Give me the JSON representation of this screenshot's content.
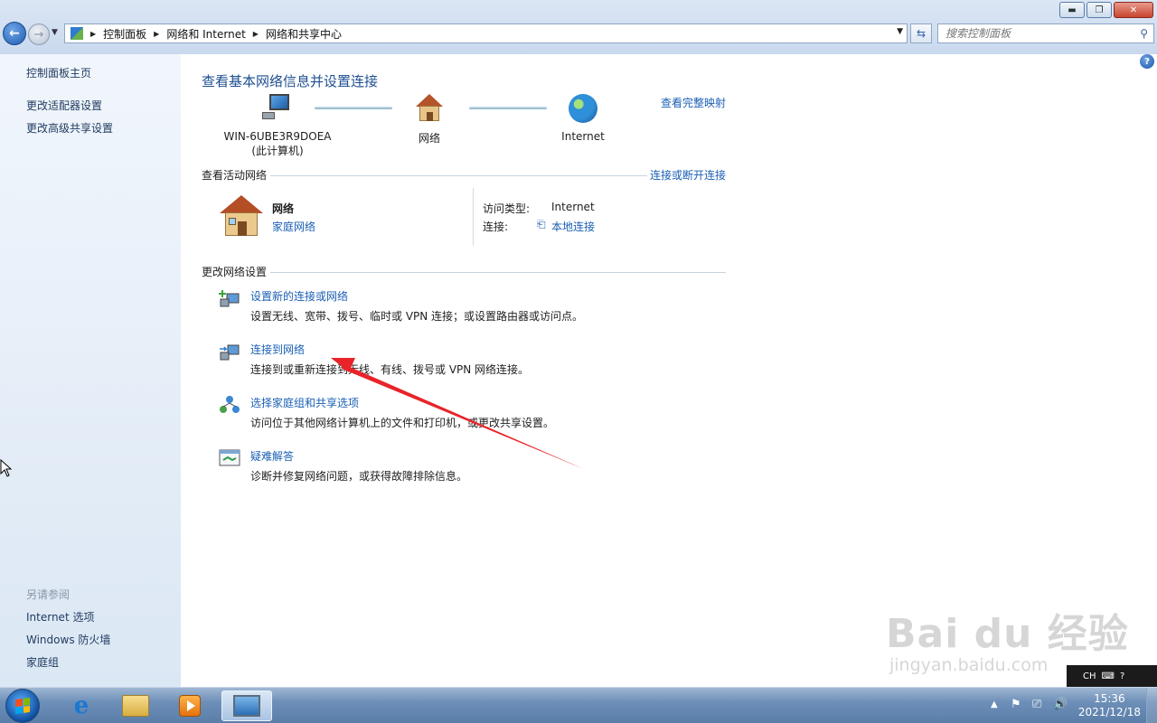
{
  "window": {
    "controls": {
      "minimize": "▬",
      "maximize": "❐",
      "close": "✕"
    }
  },
  "nav": {
    "breadcrumbs": [
      "控制面板",
      "网络和 Internet",
      "网络和共享中心"
    ],
    "search_placeholder": "搜索控制面板"
  },
  "sidebar": {
    "links": [
      "控制面板主页",
      "更改适配器设置",
      "更改高级共享设置"
    ],
    "see_also_heading": "另请参阅",
    "see_also": [
      "Internet 选项",
      "Windows 防火墙",
      "家庭组"
    ]
  },
  "main": {
    "title": "查看基本网络信息并设置连接",
    "full_map_link": "查看完整映射",
    "map": {
      "computer_name": "WIN-6UBE3R9DOEA",
      "computer_sub": "(此计算机)",
      "network_label": "网络",
      "internet_label": "Internet"
    },
    "active_networks": {
      "heading": "查看活动网络",
      "connect_disconnect": "连接或断开连接",
      "network_name": "网络",
      "network_type": "家庭网络",
      "access_type_label": "访问类型:",
      "access_type_value": "Internet",
      "connection_label": "连接:",
      "connection_value": "本地连接"
    },
    "change_settings": {
      "heading": "更改网络设置",
      "tasks": [
        {
          "title": "设置新的连接或网络",
          "desc": "设置无线、宽带、拨号、临时或 VPN 连接；或设置路由器或访问点。",
          "icon": "new-connection-icon"
        },
        {
          "title": "连接到网络",
          "desc": "连接到或重新连接到无线、有线、拨号或 VPN 网络连接。",
          "icon": "connect-network-icon"
        },
        {
          "title": "选择家庭组和共享选项",
          "desc": "访问位于其他网络计算机上的文件和打印机，或更改共享设置。",
          "icon": "homegroup-icon"
        },
        {
          "title": "疑难解答",
          "desc": "诊断并修复网络问题，或获得故障排除信息。",
          "icon": "troubleshoot-icon"
        }
      ]
    }
  },
  "taskbar": {
    "pinned": [
      "internet-explorer",
      "windows-explorer",
      "media-player",
      "control-panel"
    ],
    "lang": "CH",
    "time": "15:36",
    "date": "2021/12/18"
  },
  "watermark": {
    "main": "Bai  du 经验",
    "sub": "jingyan.baidu.com"
  },
  "colors": {
    "link": "#1a5fb4",
    "title": "#1e4f91",
    "annotation_arrow": "#e8242a"
  }
}
